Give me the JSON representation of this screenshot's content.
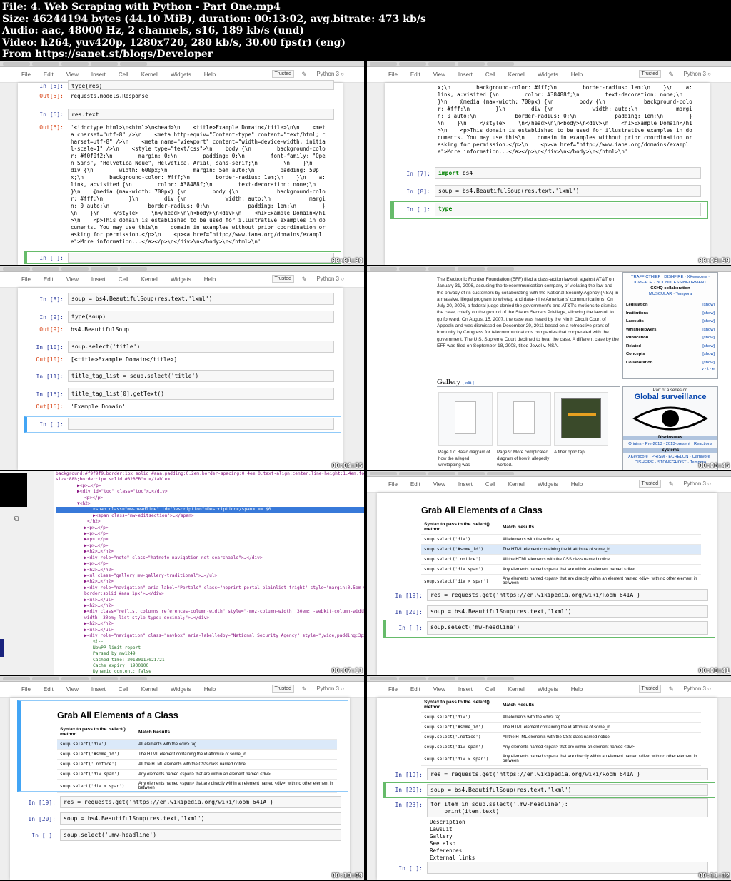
{
  "header": {
    "file": "File: 4. Web Scraping with Python - Part One.mp4",
    "size": "Size: 46244194 bytes (44.10 MiB), duration: 00:13:02, avg.bitrate: 473 kb/s",
    "audio": "Audio: aac, 48000 Hz, 2 channels, s16, 189 kb/s (und)",
    "video": "Video: h264, yuv420p, 1280x720, 280 kb/s, 30.00 fps(r) (eng)",
    "from": "From https://sanet.st/blogs/Developer"
  },
  "menu": [
    "File",
    "Edit",
    "View",
    "Insert",
    "Cell",
    "Kernel",
    "Widgets",
    "Help"
  ],
  "trusted": "Trusted",
  "kernel": "Python 3",
  "frame1": {
    "timestamp": "00:01:30",
    "cells": [
      {
        "p": "In [5]:",
        "code": "type(res)"
      },
      {
        "p": "Out[5]:",
        "out": "requests.models.Response"
      },
      {
        "p": "In [6]:",
        "code": "res.text"
      },
      {
        "p": "Out[6]:",
        "out": "'<!doctype html>\\n<html>\\n<head>\\n    <title>Example Domain</title>\\n\\n    <met\na charset=\"utf-8\" />\\n    <meta http-equiv=\"Content-type\" content=\"text/html; c\nharset=utf-8\" />\\n    <meta name=\"viewport\" content=\"width=device-width, initia\nl-scale=1\" />\\n    <style type=\"text/css\">\\n    body {\\n        background-colo\nr: #f0f0f2;\\n        margin: 0;\\n        padding: 0;\\n        font-family: \"Ope\nn Sans\", \"Helvetica Neue\", Helvetica, Arial, sans-serif;\\n        \\n    }\\n    \ndiv {\\n        width: 600px;\\n        margin: 5em auto;\\n        padding: 50p\nx;\\n        background-color: #fff;\\n        border-radius: 1em;\\n    }\\n    a:\nlink, a:visited {\\n        color: #38488f;\\n        text-decoration: none;\\n\n}\\n    @media (max-width: 700px) {\\n        body {\\n            background-colo\nr: #fff;\\n        }\\n        div {\\n            width: auto;\\n            margi\nn: 0 auto;\\n            border-radius: 0;\\n            padding: 1em;\\n        }\n\\n    }\\n    </style>    \\n</head>\\n\\n<body>\\n<div>\\n    <h1>Example Domain</h1\n>\\n    <p>This domain is established to be used for illustrative examples in do\ncuments. You may use this\\n    domain in examples without prior coordination or\nasking for permission.</p>\\n    <p><a href=\"http://www.iana.org/domains/exampl\ne\">More information...</a></p>\\n</div>\\n</body>\\n</html>\\n'"
      },
      {
        "p": "In [ ]:",
        "code": ""
      }
    ]
  },
  "frame2": {
    "timestamp": "00:03:59",
    "out_tail": "x;\\n        background-color: #fff;\\n        border-radius: 1em;\\n    }\\n    a:\nlink, a:visited {\\n        color: #38488f;\\n        text-decoration: none;\\n\n}\\n    @media (max-width: 700px) {\\n        body {\\n            background-colo\nr: #fff;\\n        }\\n        div {\\n            width: auto;\\n            margi\nn: 0 auto;\\n            border-radius: 0;\\n            padding: 1em;\\n        }\n\\n    }\\n    </style>    \\n</head>\\n\\n<body>\\n<div>\\n    <h1>Example Domain</h1\n>\\n    <p>This domain is established to be used for illustrative examples in do\ncuments. You may use this\\n    domain in examples without prior coordination or\nasking for permission.</p>\\n    <p><a href=\"http://www.iana.org/domains/exampl\ne\">More information...</a></p>\\n</div>\\n</body>\\n</html>\\n'",
    "cells": [
      {
        "p": "In [7]:",
        "code": "import bs4"
      },
      {
        "p": "In [8]:",
        "code": "soup = bs4.BeautifulSoup(res.text,'lxml')"
      },
      {
        "p": "In [ ]:",
        "code": "type"
      }
    ]
  },
  "frame3": {
    "timestamp": "00:04:35",
    "cells": [
      {
        "p": "In [8]:",
        "code": "soup = bs4.BeautifulSoup(res.text,'lxml')"
      },
      {
        "p": "In [9]:",
        "code": "type(soup)"
      },
      {
        "p": "Out[9]:",
        "out": "bs4.BeautifulSoup"
      },
      {
        "p": "In [10]:",
        "code": "soup.select('title')"
      },
      {
        "p": "Out[10]:",
        "out": "[<title>Example Domain</title>]"
      },
      {
        "p": "In [11]:",
        "code": "title_tag_list = soup.select('title')"
      },
      {
        "p": "In [16]:",
        "code": "title_tag_list[0].getText()"
      },
      {
        "p": "Out[16]:",
        "out": "'Example Domain'"
      },
      {
        "p": "In [ ]:",
        "code": ""
      }
    ]
  },
  "frame4": {
    "timestamp": "00:06:45",
    "article": "The Electronic Frontier Foundation (EFF) filed a class-action lawsuit against AT&T on January 31, 2006, accusing the telecommunication company of violating the law and the privacy of its customers by collaborating with the National Security Agency (NSA) in a massive, illegal program to wiretap and data-mine Americans' communications. On July 20, 2006, a federal judge denied the government's and AT&T's motions to dismiss the case, chiefly on the ground of the States Secrets Privilege, allowing the lawsuit to go forward. On August 15, 2007, the case was heard by the Ninth Circuit Court of Appeals and was dismissed on December 29, 2011 based on a retroactive grant of immunity by Congress for telecommunications companies that cooperated with the government. The U.S. Supreme Court declined to hear the case. A different case by the EFF was filed on September 18, 2008, titled Jewel v. NSA.",
    "gallery": "Gallery",
    "edit": "[ edit ]",
    "captions": [
      "Page 17: Basic diagram of how the alleged wiretapping was",
      "Page 9: More complicated diagram of how it allegedly worked.",
      "A fiber optic tap."
    ],
    "side_top": [
      "TRAFFICTHIEF · DISHFIRE · XKeyscore ·",
      "ICREACH · BOUNDLESSINFORMANT",
      "GCHQ collaboration",
      "MUSCULAR · Tempora"
    ],
    "side_rows": [
      "Legislation",
      "Institutions",
      "Lawsuits",
      "Whistleblowers",
      "Publication",
      "Related",
      "Concepts",
      "Collaboration"
    ],
    "show": "[show]",
    "vte": "v · t · e",
    "series_pre": "Part of a series on",
    "series_title": "Global surveillance",
    "disclosures": "Disclosures",
    "disc_links": "Origins · Pre-2013 · 2013-present · Reactions",
    "systems": "Systems",
    "sys_links": "XKeyscore · PRISM · ECHELON · Carnivore · DISHFIRE · STONEGHOST · Tempora"
  },
  "frame5": {
    "timestamp": "00:07:13",
    "lines": [
      "background:#f9f9f9;border:1px solid #aaa;padding:0.2em;border-spacing:0.4em 0;text-align:center;line-height:1.4em;font-",
      "size:88%;border:1px solid #82BEB\">…</table>",
      "▶<p>…</p>",
      "▶<div id=\"toc\" class=\"toc\">…</div>",
      "<p></p>",
      "▼<h2>",
      "<span class=\"mw-headline\" id=\"Description\">Description</span> == $0",
      "▶<span class=\"mw-editsection\">…</span>",
      "</h2>",
      "▶<p>…</p>",
      "▶<p>…</p>",
      "▶<p>…</p>",
      "▶<p>…</p>",
      "▶<h2>…</h2>",
      "▶<div role=\"note\" class=\"hatnote navigation-not-searchable\">…</div>",
      "▶<p>…</p>",
      "▶<h2>…</h2>",
      "▶<ul class=\"gallery mw-gallery-traditional\">…</ul>",
      "▶<h2>…</h2>",
      "▶<div role=\"navigation\" aria-label=\"Portals\" class=\"noprint portal plainlist tright\" style=\"margin:0.5em 0",
      "border:solid #aaa 1px\">…</div>",
      "▶<ul>…</ul>",
      "▶<h2>…</h2>",
      "▶<div class=\"reflist columns references-column-width\" style=\"-moz-column-width: 30em; -webkit-column-width:",
      "width: 30em; list-style-type: decimal;\">…</div>",
      "▶<h2>…</h2>",
      "▶<ul>…</ul>",
      "▶<div role=\"navigation\" class=\"navbox\" aria-labelledby=\"National_Security_Agency\" style=\";wide;padding:3px\">",
      "<!--",
      "NewPP limit report",
      "Parsed by mw1249",
      "Cached time: 20180117021721",
      "Cache expiry: 1900800",
      "Dynamic content: false"
    ]
  },
  "table": {
    "title": "Grab All Elements of a Class",
    "h1": "Syntax to pass to the .select() method",
    "h2": "Match Results",
    "rows": [
      [
        "soup.select('div')",
        "All elements with the <div> tag"
      ],
      [
        "soup.select('#some_id')",
        "The HTML element containing the id attribute of some_id"
      ],
      [
        "soup.select('.notice')",
        "All the HTML elements with the CSS class named notice"
      ],
      [
        "soup.select('div span')",
        "Any elements named <span> that are within an element named <div>"
      ],
      [
        "soup.select('div > span')",
        "Any elements named <span> that are directly within an element named <div>, with no other element in between"
      ]
    ]
  },
  "frame6": {
    "timestamp": "00:08:41",
    "cells": [
      {
        "p": "In [19]:",
        "code": "res = requests.get('https://en.wikipedia.org/wiki/Room_641A')"
      },
      {
        "p": "In [20]:",
        "code": "soup = bs4.BeautifulSoup(res.text,'lxml')"
      },
      {
        "p": "In [ ]:",
        "code": "soup.select('mw-headline')"
      }
    ]
  },
  "frame7": {
    "timestamp": "00:10:09",
    "cells": [
      {
        "p": "In [19]:",
        "code": "res = requests.get('https://en.wikipedia.org/wiki/Room_641A')"
      },
      {
        "p": "In [20]:",
        "code": "soup = bs4.BeautifulSoup(res.text,'lxml')"
      },
      {
        "p": "In [ ]:",
        "code": "soup.select('.mw-headline')"
      }
    ]
  },
  "frame8": {
    "timestamp": "00:11:32",
    "cells": [
      {
        "p": "In [19]:",
        "code": "res = requests.get('https://en.wikipedia.org/wiki/Room_641A')"
      },
      {
        "p": "In [20]:",
        "code": "soup = bs4.BeautifulSoup(res.text,'lxml')"
      },
      {
        "p": "In [23]:",
        "code": "for item in soup.select('.mw-headline'):\n    print(item.text)"
      },
      {
        "p": "",
        "out": "Description\nLawsuit\nGallery\nSee also\nReferences\nExternal links"
      },
      {
        "p": "In [ ]:",
        "code": ""
      }
    ]
  }
}
